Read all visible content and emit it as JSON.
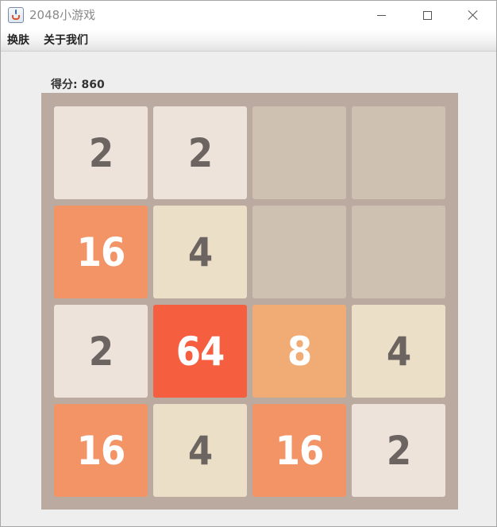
{
  "window": {
    "title": "2048小游戏"
  },
  "menu": {
    "items": [
      "换肤",
      "关于我们"
    ]
  },
  "score": {
    "text": "得分: 860",
    "value": 860
  },
  "board": {
    "size": 4,
    "grid": [
      [
        2,
        2,
        0,
        0
      ],
      [
        16,
        4,
        0,
        0
      ],
      [
        2,
        64,
        8,
        4
      ],
      [
        16,
        4,
        16,
        2
      ]
    ]
  },
  "colors": {
    "board_bg": "#bbaa9f",
    "empty": "#cec1b2",
    "tiles": {
      "2": {
        "bg": "#ede3da",
        "fg": "#6b6460"
      },
      "4": {
        "bg": "#ecdfc7",
        "fg": "#6b6460"
      },
      "8": {
        "bg": "#f0ac74",
        "fg": "#ffffff"
      },
      "16": {
        "bg": "#f39466",
        "fg": "#ffffff"
      },
      "64": {
        "bg": "#f55e3f",
        "fg": "#ffffff"
      }
    }
  }
}
